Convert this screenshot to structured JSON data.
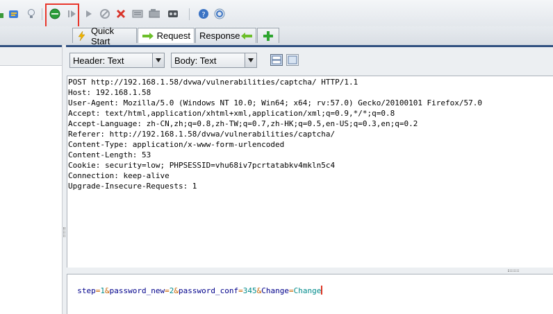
{
  "toolbar": {
    "icons": [
      "refresh-icon",
      "scroll-icon",
      "lightbulb-icon",
      "break-on-requests-icon",
      "step-icon",
      "continue-icon",
      "drop-icon",
      "cancel-icon",
      "filter-icon",
      "scan-icon",
      "session-icon",
      "help-icon",
      "report-icon"
    ],
    "highlight_color": "#e8362b"
  },
  "tabs": {
    "quick_start": "Quick Start",
    "request": "Request",
    "response": "Response",
    "add": "+"
  },
  "selectors": {
    "header_format": "Header: Text",
    "body_format": "Body: Text"
  },
  "request_headers": [
    "POST http://192.168.1.58/dvwa/vulnerabilities/captcha/ HTTP/1.1",
    "Host: 192.168.1.58",
    "User-Agent: Mozilla/5.0 (Windows NT 10.0; Win64; x64; rv:57.0) Gecko/20100101 Firefox/57.0",
    "Accept: text/html,application/xhtml+xml,application/xml;q=0.9,*/*;q=0.8",
    "Accept-Language: zh-CN,zh;q=0.8,zh-TW;q=0.7,zh-HK;q=0.5,en-US;q=0.3,en;q=0.2",
    "Referer: http://192.168.1.58/dvwa/vulnerabilities/captcha/",
    "Content-Type: application/x-www-form-urlencoded",
    "Content-Length: 53",
    "Cookie: security=low; PHPSESSID=vhu68iv7pcrtatabkv4mkln5c4",
    "Connection: keep-alive",
    "Upgrade-Insecure-Requests: 1"
  ],
  "request_body": {
    "params": [
      {
        "key": "step",
        "value": "1"
      },
      {
        "key": "password_new",
        "value": "2"
      },
      {
        "key": "password_conf",
        "value": "345"
      },
      {
        "key": "Change",
        "value": "Change"
      }
    ]
  }
}
